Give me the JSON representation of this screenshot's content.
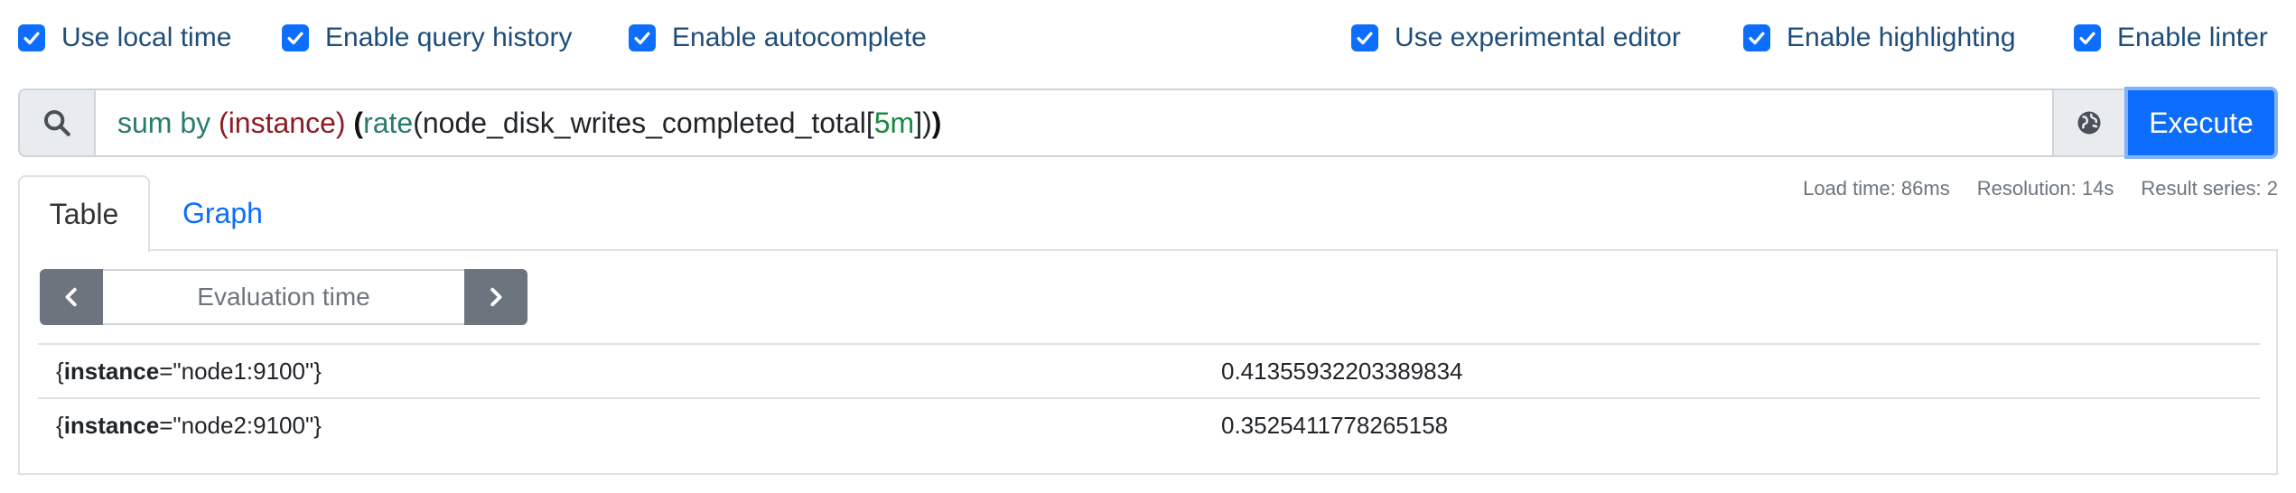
{
  "options": {
    "local_time": "Use local time",
    "query_history": "Enable query history",
    "autocomplete": "Enable autocomplete",
    "experimental_editor": "Use experimental editor",
    "highlighting": "Enable highlighting",
    "linter": "Enable linter"
  },
  "query": {
    "t1": "sum",
    "t2": " by ",
    "t3": "(",
    "t4": "instance",
    "t5": ")",
    "t6": " ",
    "t7": "(",
    "t8": "rate",
    "t9": "(",
    "t10": "node_disk_writes_completed_total",
    "t11": "[",
    "t12": "5m",
    "t13": "]",
    "t14": ")",
    "t15": ")"
  },
  "execute_label": "Execute",
  "stats": {
    "load_time": "Load time: 86ms",
    "resolution": "Resolution: 14s",
    "result_series": "Result series: 2"
  },
  "tabs": {
    "table": "Table",
    "graph": "Graph"
  },
  "eval_time_placeholder": "Evaluation time",
  "results": [
    {
      "open": "{",
      "label_name": "instance",
      "eq": "=\"",
      "label_value": "node1:9100",
      "close": "\"}",
      "value": "0.41355932203389834"
    },
    {
      "open": "{",
      "label_name": "instance",
      "eq": "=\"",
      "label_value": "node2:9100",
      "close": "\"}",
      "value": "0.3525411778265158"
    }
  ],
  "colors": {
    "primary": "#0d6efd",
    "secondary": "#6c757d",
    "option_text": "#1e4d78"
  },
  "icons": {
    "search": "search-icon",
    "globe": "globe-icon",
    "prev": "chevron-left-icon",
    "next": "chevron-right-icon",
    "check": "check-icon"
  }
}
